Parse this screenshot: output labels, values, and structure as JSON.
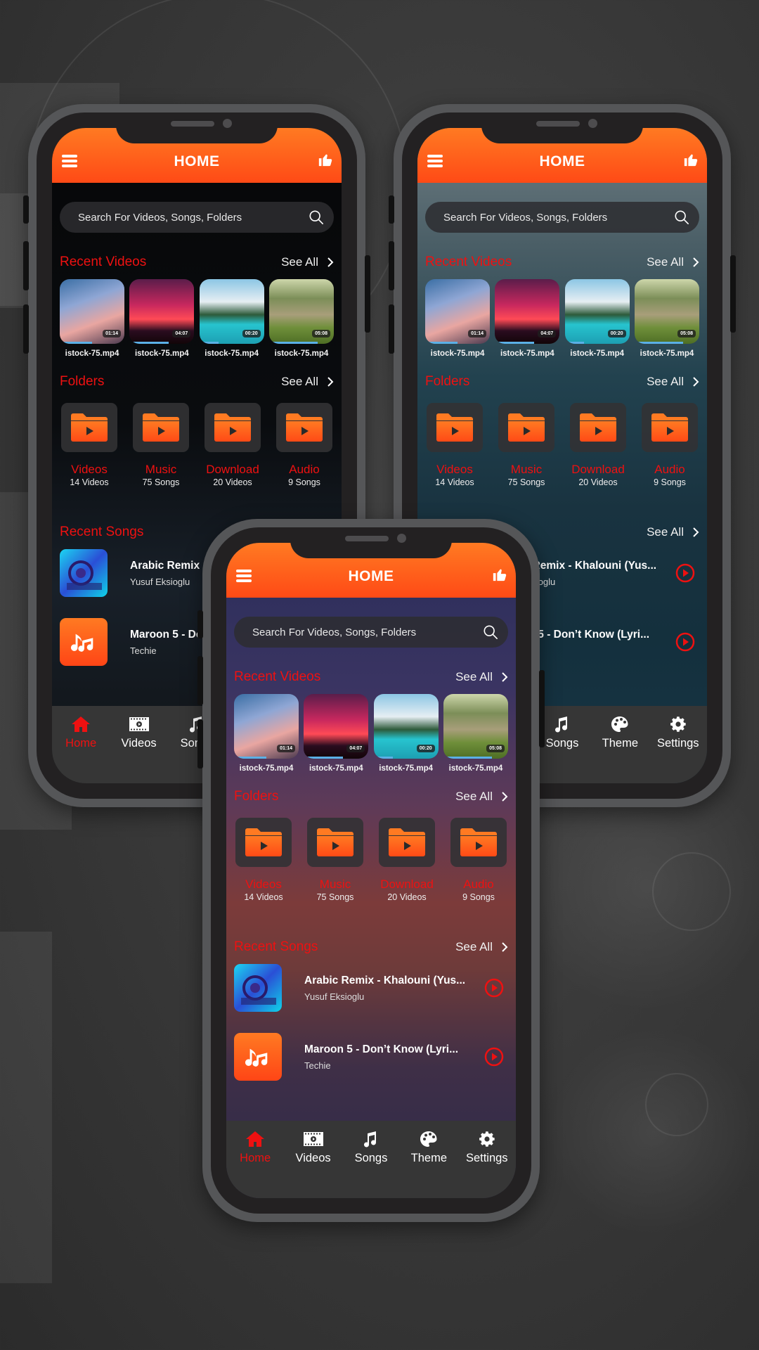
{
  "app": {
    "title": "HOME",
    "menu_icon": "hamburger-menu-icon",
    "like_icon": "thumbs-up-icon",
    "accent_color": "#ff5a1a",
    "section_title_color": "#ee1111"
  },
  "search": {
    "placeholder": "Search For Videos, Songs, Folders",
    "value": "",
    "icon": "search-icon"
  },
  "recent_videos": {
    "title": "Recent Videos",
    "see_all": "See All",
    "items": [
      {
        "name": "istock-75.mp4",
        "duration": "01:14",
        "progress": 0.5
      },
      {
        "name": "istock-75.mp4",
        "duration": "04:07",
        "progress": 0.6
      },
      {
        "name": "istock-75.mp4",
        "duration": "00:20",
        "progress": 0.3
      },
      {
        "name": "istock-75.mp4",
        "duration": "05:08",
        "progress": 0.75
      }
    ]
  },
  "folders": {
    "title": "Folders",
    "see_all": "See All",
    "items": [
      {
        "name": "Videos",
        "count": "14 Videos"
      },
      {
        "name": "Music",
        "count": "75 Songs"
      },
      {
        "name": "Download",
        "count": "20 Videos"
      },
      {
        "name": "Audio",
        "count": "9 Songs"
      }
    ]
  },
  "recent_songs": {
    "title": "Recent Songs",
    "see_all": "See All",
    "items": [
      {
        "title": "Arabic Remix - Khalouni (Yus...",
        "artist": "Yusuf Eksioglu"
      },
      {
        "title": "Maroon 5 - Don’t Know (Lyri...",
        "artist": "Techie"
      }
    ]
  },
  "bottom_nav": {
    "active": "Home",
    "items": [
      {
        "label": "Home",
        "icon": "home-icon"
      },
      {
        "label": "Videos",
        "icon": "film-icon"
      },
      {
        "label": "Songs",
        "icon": "music-note-icon"
      },
      {
        "label": "Theme",
        "icon": "palette-icon"
      },
      {
        "label": "Settings",
        "icon": "gear-icon"
      }
    ]
  }
}
